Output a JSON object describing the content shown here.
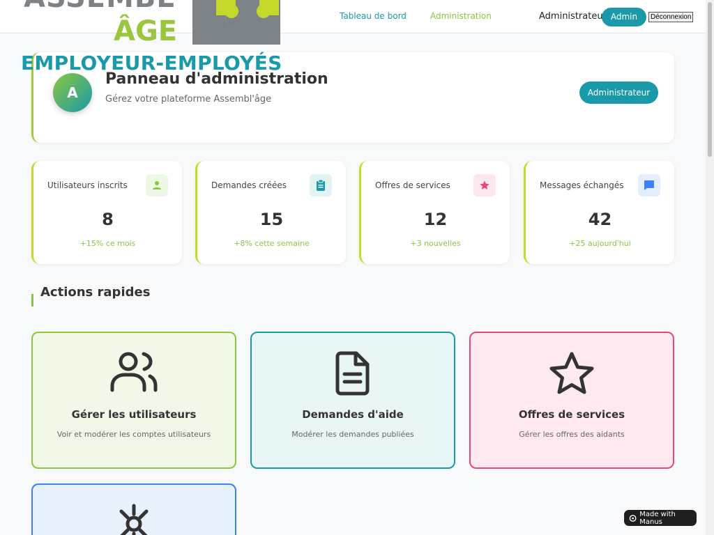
{
  "brand": {
    "word_top": "ASSEMBL",
    "word_age": "ÂGE",
    "tagline": "EMPLOYEUR-EMPLOYÉS",
    "colors": {
      "primary": "#1a9aa8",
      "accent": "#8cc63f",
      "grey": "#7d8287"
    }
  },
  "header": {
    "nav": {
      "dashboard": "Tableau de bord",
      "admin": "Administration"
    },
    "user_name": "Administrateur",
    "role_pill": "Admin",
    "logout_label": "Déconnexion"
  },
  "welcome": {
    "avatar_letter": "A",
    "title": "Panneau d'administration",
    "subtitle": "Gérez votre plateforme Assembl'âge",
    "role_button": "Administrateur"
  },
  "stats": [
    {
      "label": "Utilisateurs inscrits",
      "value": "8",
      "change": "+15% ce mois",
      "icon": "user-icon",
      "icon_color": "#8cc63f",
      "icon_bg": "#eef7e3"
    },
    {
      "label": "Demandes créées",
      "value": "15",
      "change": "+8% cette semaine",
      "icon": "clipboard-icon",
      "icon_color": "#1a9aa8",
      "icon_bg": "#e2f3f4"
    },
    {
      "label": "Offres de services",
      "value": "12",
      "change": "+3 nouvelles",
      "icon": "star-icon",
      "icon_color": "#e9457a",
      "icon_bg": "#fde6ee"
    },
    {
      "label": "Messages échangés",
      "value": "42",
      "change": "+25 aujourd'hui",
      "icon": "chat-icon",
      "icon_color": "#3b82f6",
      "icon_bg": "#e4eefc"
    }
  ],
  "quick_actions": {
    "title": "Actions rapides",
    "items": [
      {
        "title": "Gérer les utilisateurs",
        "desc": "Voir et modérer les comptes utilisateurs",
        "icon": "users-icon",
        "border": "#8cc63f",
        "bg": "#f1f8e8"
      },
      {
        "title": "Demandes d'aide",
        "desc": "Modérer les demandes publiées",
        "icon": "document-icon",
        "border": "#1a9aa8",
        "bg": "#e8f6f6"
      },
      {
        "title": "Offres de services",
        "desc": "Gérer les offres des aidants",
        "icon": "star-outline-icon",
        "border": "#e9457a",
        "bg": "#fde9ef"
      },
      {
        "title": "",
        "desc": "",
        "icon": "settings-icon",
        "border": "#3b82f6",
        "bg": "#e6f1fc"
      }
    ]
  },
  "badge": {
    "label": "Made with Manus"
  }
}
